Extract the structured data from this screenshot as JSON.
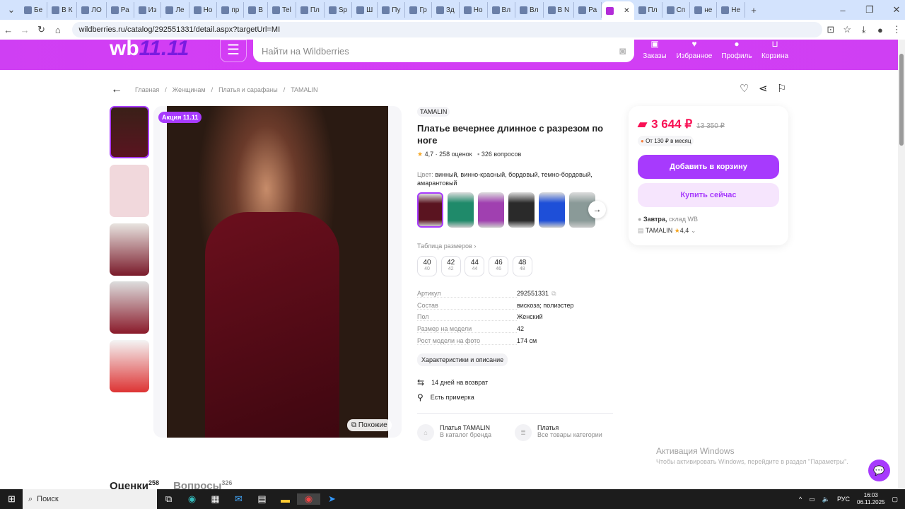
{
  "browser": {
    "tabs": [
      "Бе",
      "В К",
      "ЛО",
      "Ра",
      "Из",
      "Ле",
      "Но",
      "пр",
      "В",
      "Tel",
      "Пл",
      "Sp",
      "Ш",
      "Пу",
      "Гр",
      "Зд",
      "Но",
      "Вл",
      "Вл",
      "В N",
      "Ра",
      "",
      "Пл",
      "Сп",
      "не",
      "Не"
    ],
    "active_tab": 21,
    "url": "wildberries.ru/catalog/292551331/detail.aspx?targetUrl=MI"
  },
  "header": {
    "logo": "wb",
    "logo_promo": "11.11",
    "search_placeholder": "Найти на Wildberries",
    "nav": [
      "Заказы",
      "Избранное",
      "Профиль",
      "Корзина"
    ]
  },
  "breadcrumb": [
    "Главная",
    "Женщинам",
    "Платья и сарафаны",
    "TAMALIN"
  ],
  "gallery": {
    "promo_badge": "Акция 11.11",
    "similar_label": "Похожие"
  },
  "product": {
    "brand": "TAMALIN",
    "title": "Платье вечернее длинное с разрезом по ноге",
    "rating": "4,7",
    "reviews": "258 оценок",
    "questions": "326 вопросов",
    "color_label": "Цвет:",
    "color_value": "винный, винно-красный, бордовый, темно-бордовый, амарантовый",
    "swatch_colors": [
      "#5a1420",
      "#1f8a6a",
      "#a040b0",
      "#2a2a2a",
      "#1e4fd8",
      "#8a9a98"
    ],
    "size_table": "Таблица размеров",
    "sizes": [
      [
        "40",
        "40"
      ],
      [
        "42",
        "42"
      ],
      [
        "44",
        "44"
      ],
      [
        "46",
        "46"
      ],
      [
        "48",
        "48"
      ]
    ],
    "params": [
      [
        "Артикул",
        "292551331"
      ],
      [
        "Состав",
        "вискоза; полиэстер"
      ],
      [
        "Пол",
        "Женский"
      ],
      [
        "Размер на модели",
        "42"
      ],
      [
        "Рост модели на фото",
        "174 см"
      ]
    ],
    "chars_button": "Характеристики и описание",
    "return": "14 дней на возврат",
    "fitting": "Есть примерка",
    "brand_link": {
      "title": "Платья TAMALIN",
      "sub": "В каталог бренда"
    },
    "category_link": {
      "title": "Платья",
      "sub": "Все товары категории"
    }
  },
  "buy": {
    "price": "3 644 ₽",
    "old_price": "13 350 ₽",
    "installment": "От 130 ₽ в месяц",
    "add_to_cart": "Добавить в корзину",
    "buy_now": "Купить сейчас",
    "delivery_bold": "Завтра,",
    "delivery_rest": "склад WB",
    "seller": "TAMALIN",
    "seller_rating": "4,4"
  },
  "bottom_tabs": {
    "reviews": "Оценки",
    "reviews_count": "258",
    "questions": "Вопросы",
    "questions_count": "326"
  },
  "windows": {
    "activation_title": "Активация Windows",
    "activation_text": "Чтобы активировать Windows, перейдите в раздел \"Параметры\".",
    "search": "Поиск",
    "lang": "РУС",
    "time": "16:03",
    "date": "06.11.2025"
  },
  "colors": {
    "accent": "#a73afd",
    "price": "#f91155",
    "header": "#d43df5"
  }
}
